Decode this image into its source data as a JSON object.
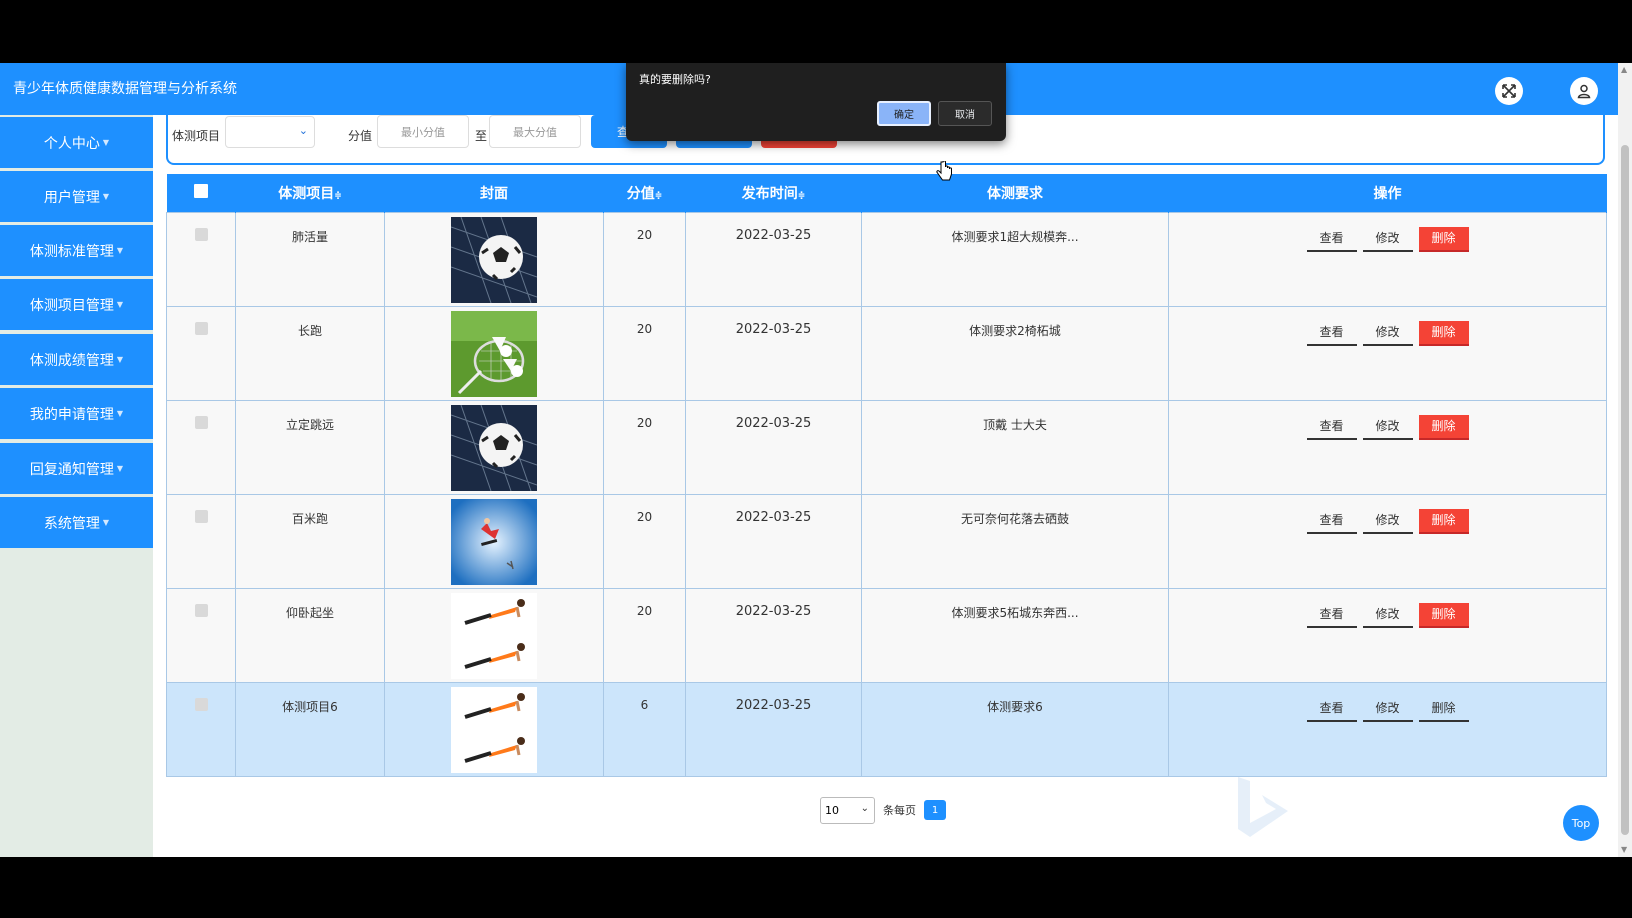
{
  "app": {
    "title": "青少年体质健康数据管理与分析系统"
  },
  "header": {
    "fullscreen_icon": "expand-icon",
    "user_icon": "user-icon"
  },
  "sidebar": {
    "items": [
      {
        "label": "个人中心"
      },
      {
        "label": "用户管理"
      },
      {
        "label": "体测标准管理"
      },
      {
        "label": "体测项目管理"
      },
      {
        "label": "体测成绩管理"
      },
      {
        "label": "我的申请管理"
      },
      {
        "label": "回复通知管理"
      },
      {
        "label": "系统管理"
      }
    ]
  },
  "filter": {
    "project_label": "体测项目",
    "project_value": "",
    "score_label": "分值",
    "min_placeholder": "最小分值",
    "to_label": "至",
    "max_placeholder": "最大分值",
    "query_button": "查"
  },
  "table": {
    "headers": {
      "project": "体测项目",
      "cover": "封面",
      "score": "分值",
      "time": "发布时间",
      "requirement": "体测要求",
      "ops": "操作"
    },
    "sort_icon": "≑",
    "rows": [
      {
        "project": "肺活量",
        "cover": "soccer-ball-net",
        "score": "20",
        "time": "2022-03-25",
        "requirement": "体测要求1超大规模奔..."
      },
      {
        "project": "长跑",
        "cover": "badminton-racket-shuttlecock",
        "score": "20",
        "time": "2022-03-25",
        "requirement": "体测要求2椅柘城"
      },
      {
        "project": "立定跳远",
        "cover": "soccer-ball-net",
        "score": "20",
        "time": "2022-03-25",
        "requirement": "顶戴 士大夫"
      },
      {
        "project": "百米跑",
        "cover": "skateboard-jump-sky",
        "score": "20",
        "time": "2022-03-25",
        "requirement": "无可奈何花落去硒鼓"
      },
      {
        "project": "仰卧起坐",
        "cover": "plank-exercise",
        "score": "20",
        "time": "2022-03-25",
        "requirement": "体测要求5柘城东奔西..."
      },
      {
        "project": "体测项目6",
        "cover": "plank-exercise",
        "score": "6",
        "time": "2022-03-25",
        "requirement": "体测要求6"
      }
    ],
    "ops": {
      "view": "查看",
      "edit": "修改",
      "delete": "删除"
    }
  },
  "pagination": {
    "page_size": "10",
    "per_page_label": "条每页",
    "current_page": "1"
  },
  "top_button": "Top",
  "dialog": {
    "message": "真的要删除吗?",
    "ok": "确定",
    "cancel": "取消"
  },
  "colors": {
    "primary": "#1e90ff",
    "danger": "#f44336",
    "dialog_bg": "#1f1f1f"
  }
}
